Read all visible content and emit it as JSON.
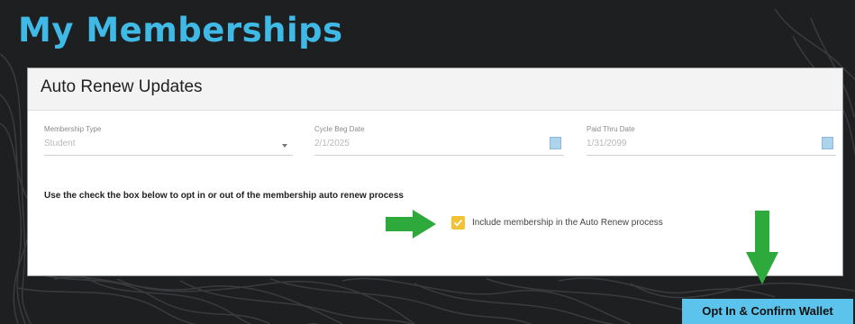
{
  "page": {
    "title": "My Memberships"
  },
  "panel": {
    "header": "Auto Renew Updates",
    "fields": {
      "membership_type": {
        "label": "Membership Type",
        "value": "Student"
      },
      "cycle_beg_date": {
        "label": "Cycle Beg Date",
        "value": "2/1/2025"
      },
      "paid_thru_date": {
        "label": "Paid Thru Date",
        "value": "1/31/2099"
      }
    },
    "instruction": "Use the check the box below to opt in or out of the membership auto renew process",
    "auto_renew_checkbox": {
      "checked": true,
      "label": "Include membership in the Auto Renew process"
    }
  },
  "actions": {
    "opt_in_label": "Opt In & Confirm Wallet"
  },
  "icons": {
    "annotation_arrows": "green-arrow-icon",
    "date_picker": "calendar-icon",
    "dropdown": "chevron-down-icon"
  },
  "colors": {
    "title": "#3fb9e6",
    "checkbox": "#f3c233",
    "cta": "#5cc4ec",
    "annotation_arrow": "#2eaa3c",
    "background": "#1e1f21"
  }
}
